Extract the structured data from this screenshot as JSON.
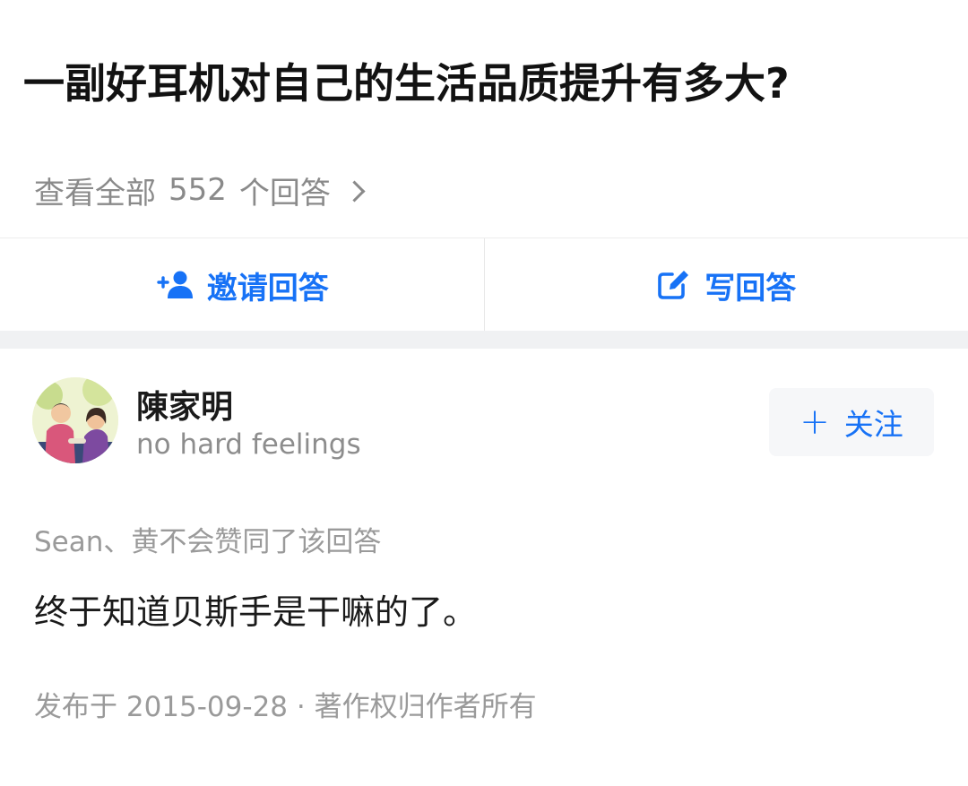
{
  "question": {
    "title": "一副好耳机对自己的生活品质提升有多大?",
    "view_all_prefix": "查看全部",
    "answer_count": "552",
    "view_all_suffix": "个回答"
  },
  "actions": {
    "invite_label": "邀请回答",
    "write_label": "写回答"
  },
  "answer": {
    "author_name": "陳家明",
    "author_bio": "no hard feelings",
    "follow_label": "关注",
    "voters_text": "Sean、黄不会赞同了该回答",
    "content": "终于知道贝斯手是干嘛的了。",
    "meta": "发布于 2015-09-28 · 著作权归作者所有"
  },
  "colors": {
    "accent": "#1772f6",
    "muted_text": "#8a8a8a",
    "divider_bg": "#f0f1f3"
  },
  "icons": {
    "invite": "add-user-icon",
    "write": "edit-icon",
    "chevron": "chevron-right-icon",
    "follow": "plus-icon"
  }
}
